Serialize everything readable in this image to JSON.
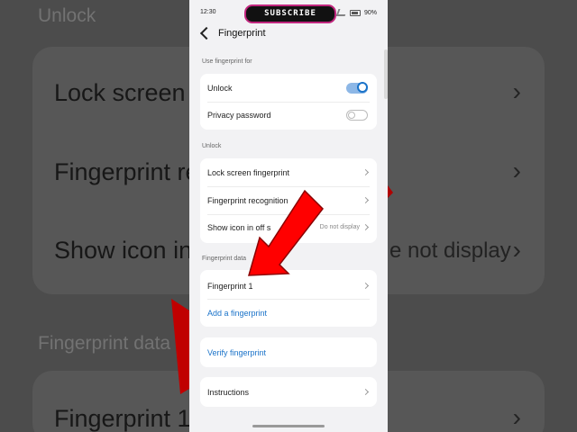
{
  "status": {
    "time": "12:30",
    "battery": "90%"
  },
  "overlay": {
    "subscribe_label": "SUBSCRIBE"
  },
  "header": {
    "title": "Fingerprint"
  },
  "sections": {
    "use_for": {
      "label": "Use fingerprint for",
      "items": [
        {
          "label": "Unlock",
          "toggle": true
        },
        {
          "label": "Privacy password",
          "toggle": false
        }
      ]
    },
    "unlock": {
      "label": "Unlock",
      "items": [
        {
          "label": "Lock screen fingerprint"
        },
        {
          "label": "Fingerprint recognition"
        },
        {
          "label": "Show icon in off s",
          "value": "Do not display"
        }
      ]
    },
    "data": {
      "label": "Fingerprint data",
      "items": [
        {
          "label": "Fingerprint 1"
        },
        {
          "label": "Add a fingerprint"
        }
      ]
    },
    "verify": {
      "label": "Verify fingerprint"
    },
    "instructions": {
      "label": "Instructions"
    }
  },
  "background": {
    "unlock": "Unlock",
    "lock_screen": "Lock screen",
    "fingerprint_re": "Fingerprint re",
    "show_icon": "Show icon in",
    "not_display": "e not display",
    "fingerprint_data": "Fingerprint data",
    "fingerprint_1": "Fingerprint 1"
  },
  "colors": {
    "accent": "#1a73c9",
    "arrow": "#ff0000"
  }
}
